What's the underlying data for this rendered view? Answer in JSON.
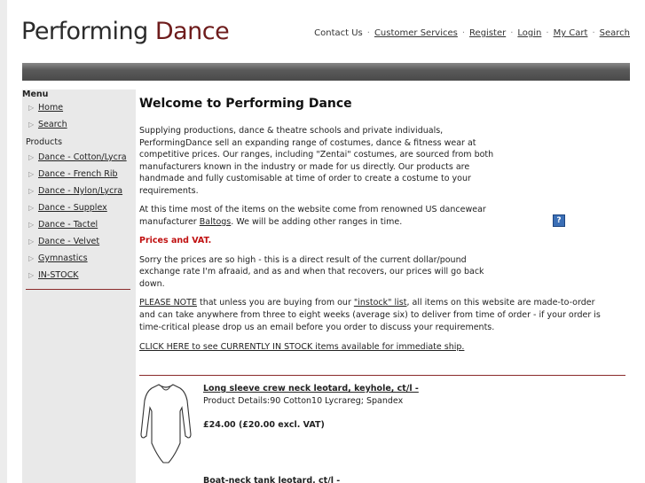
{
  "logo": {
    "word1": "Performing",
    "word2": "Dance"
  },
  "topnav": {
    "contact": "Contact Us",
    "customer_services": "Customer Services",
    "register": "Register",
    "login": "Login",
    "cart": "My Cart",
    "search": "Search",
    "separator": "·"
  },
  "sidebar": {
    "menu_heading": "Menu",
    "menu_items": [
      "Home",
      "Search"
    ],
    "products_heading": "Products",
    "product_items": [
      "Dance - Cotton/Lycra",
      "Dance - French Rib",
      "Dance - Nylon/Lycra",
      "Dance - Supplex",
      "Dance - Tactel",
      "Dance - Velvet",
      "Gymnastics",
      "IN-STOCK"
    ]
  },
  "main": {
    "title": "Welcome to Performing Dance",
    "intro": "Supplying productions, dance & theatre schools and private individuals, PerformingDance sell an expanding range of costumes, dance & fitness wear at competitive prices. Our ranges, including \"Zentai\" costumes, are sourced from both manufacturers known in the industry or made for us directly. Our products are handmade and fully customisable at time of order to create a costume to your requirements.",
    "baltogs_pre": "At this time most of the items on the website come from renowned US dancewear manufacturer ",
    "baltogs_link": "Baltogs",
    "baltogs_post": ". We will be adding other ranges in time.",
    "prices_heading": "Prices and VAT.",
    "prices_text": "Sorry the prices are so high - this is a direct result of the current dollar/pound exchange rate I'm afraaid, and as and when that recovers, our prices will go back down.",
    "please_note_link": "PLEASE NOTE",
    "please_note_mid": " that unless you are buying from our ",
    "instock_list_link": "\"instock\" list",
    "please_note_rest": ", all items on this website are made-to-order and can take anywhere from three to eight weeks (average six) to deliver from time of order - if your order is time-critical please drop us an email before you order to discuss your requirements.",
    "click_here": "CLICK HERE to see CURRENTLY IN STOCK items available for immediate ship.",
    "help_icon_label": "?"
  },
  "products": [
    {
      "title": "Long sleeve crew neck leotard, keyhole, ct/l -",
      "details": "Product Details:90 Cotton10 Lycrareg; Spandex",
      "price": "£24.00 (£20.00 excl. VAT)"
    },
    {
      "title": "Boat-neck tank leotard, ct/l -"
    }
  ]
}
